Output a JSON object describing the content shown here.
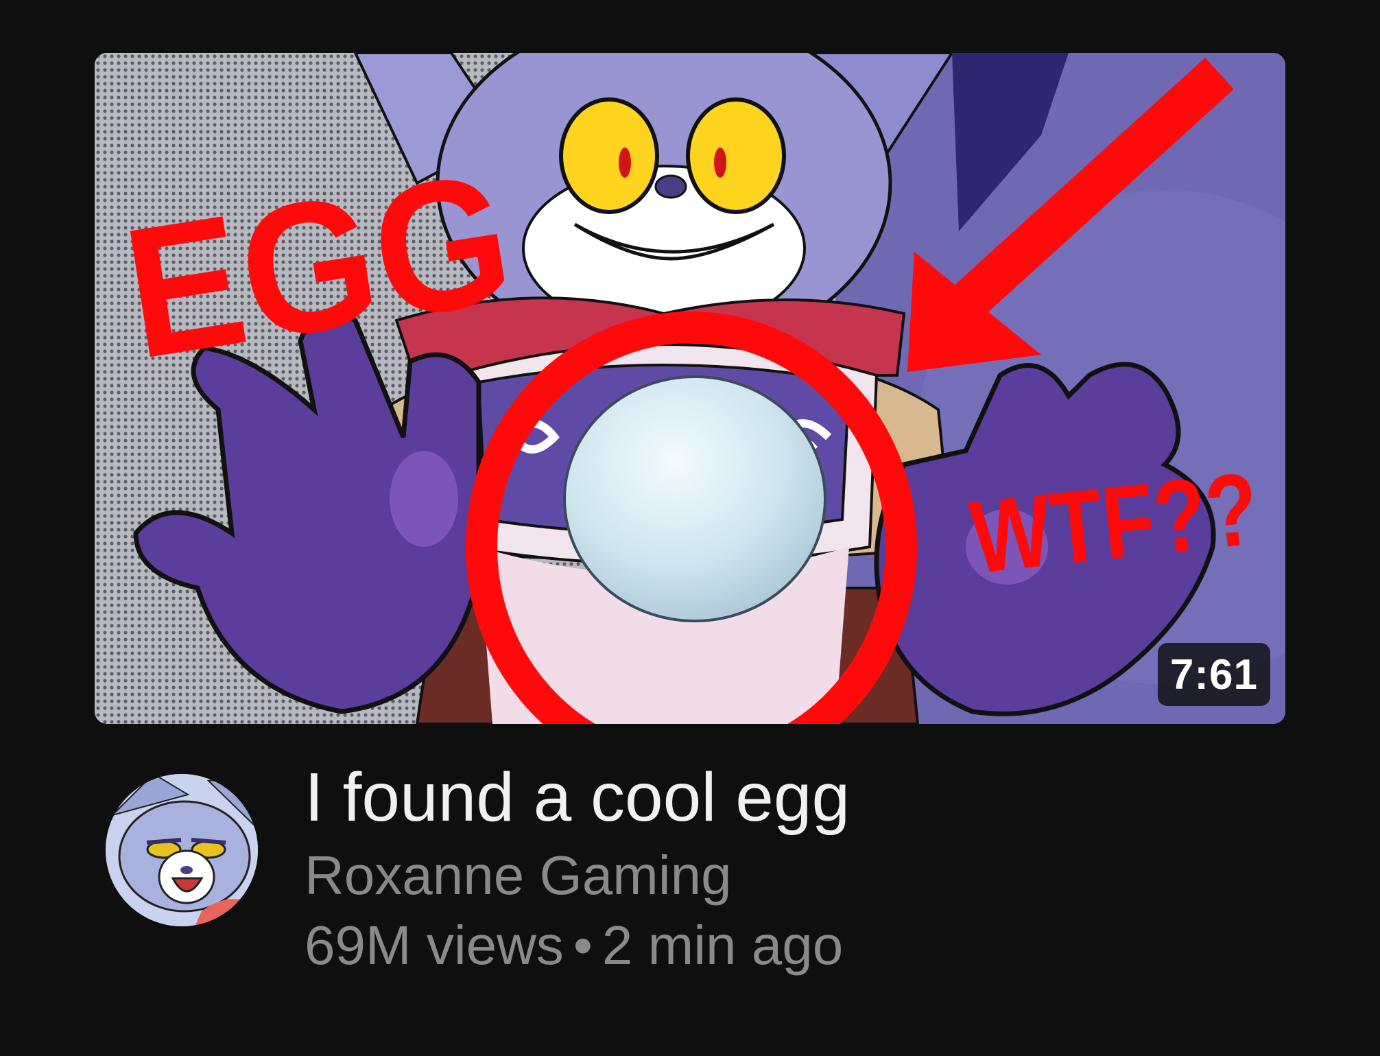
{
  "video": {
    "title": "I found a cool egg",
    "duration": "7:61",
    "thumbnail_text": {
      "top_left": "EGG",
      "right": "WTF??"
    },
    "thumbnail_colors": {
      "overlay_red": "#ff0a0a",
      "character_purple": "#7d74c4",
      "glove_purple": "#5a3d9a",
      "background_purple": "#6f68b3"
    }
  },
  "channel": {
    "name": "Roxanne Gaming",
    "avatar": "roxanne-avatar"
  },
  "stats": {
    "views": "69M views",
    "separator": "•",
    "age": "2 min ago"
  },
  "theme": {
    "background": "#0f0f0f",
    "title_color": "#f1f1f1",
    "secondary_text": "#8a8a8a"
  }
}
